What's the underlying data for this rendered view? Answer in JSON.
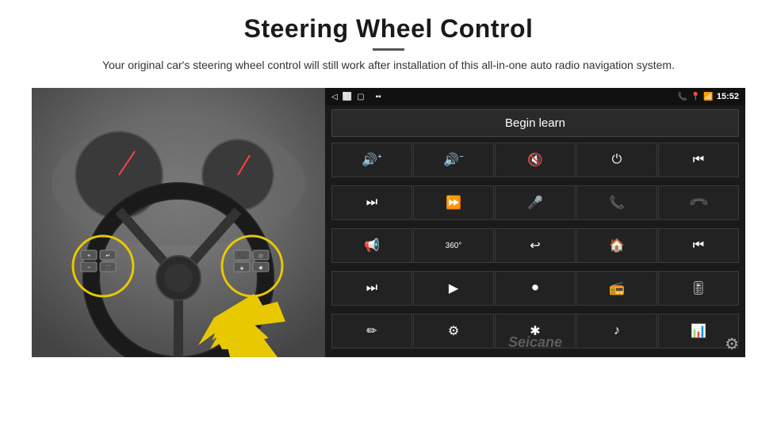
{
  "header": {
    "title": "Steering Wheel Control",
    "subtitle": "Your original car's steering wheel control will still work after installation of this all-in-one auto radio navigation system."
  },
  "status_bar": {
    "time": "15:52",
    "icons_left": [
      "◁",
      "⬜",
      "▢"
    ],
    "icons_right": [
      "📞",
      "📍",
      "📶"
    ]
  },
  "begin_learn": {
    "label": "Begin learn"
  },
  "control_buttons": [
    {
      "icon": "🔊+",
      "name": "vol-up"
    },
    {
      "icon": "🔊−",
      "name": "vol-down"
    },
    {
      "icon": "🔇",
      "name": "mute"
    },
    {
      "icon": "⏻",
      "name": "power"
    },
    {
      "icon": "⏮",
      "name": "prev-track"
    },
    {
      "icon": "⏭",
      "name": "next-track"
    },
    {
      "icon": "⏩",
      "name": "fast-forward"
    },
    {
      "icon": "🎤",
      "name": "mic"
    },
    {
      "icon": "📞",
      "name": "call"
    },
    {
      "icon": "↩",
      "name": "hang-up"
    },
    {
      "icon": "📢",
      "name": "announce"
    },
    {
      "icon": "360°",
      "name": "camera-360"
    },
    {
      "icon": "↩",
      "name": "back"
    },
    {
      "icon": "🏠",
      "name": "home"
    },
    {
      "icon": "⏮⏮",
      "name": "prev"
    },
    {
      "icon": "⏭⏭",
      "name": "next"
    },
    {
      "icon": "▶",
      "name": "play"
    },
    {
      "icon": "⏺",
      "name": "source"
    },
    {
      "icon": "📻",
      "name": "radio"
    },
    {
      "icon": "🎚",
      "name": "eq"
    },
    {
      "icon": "✏",
      "name": "edit"
    },
    {
      "icon": "⚙",
      "name": "settings-dot"
    },
    {
      "icon": "✱",
      "name": "bluetooth"
    },
    {
      "icon": "♪",
      "name": "music"
    },
    {
      "icon": "📊",
      "name": "equalizer"
    }
  ],
  "watermark": "Seicane",
  "settings_icon": "⚙"
}
